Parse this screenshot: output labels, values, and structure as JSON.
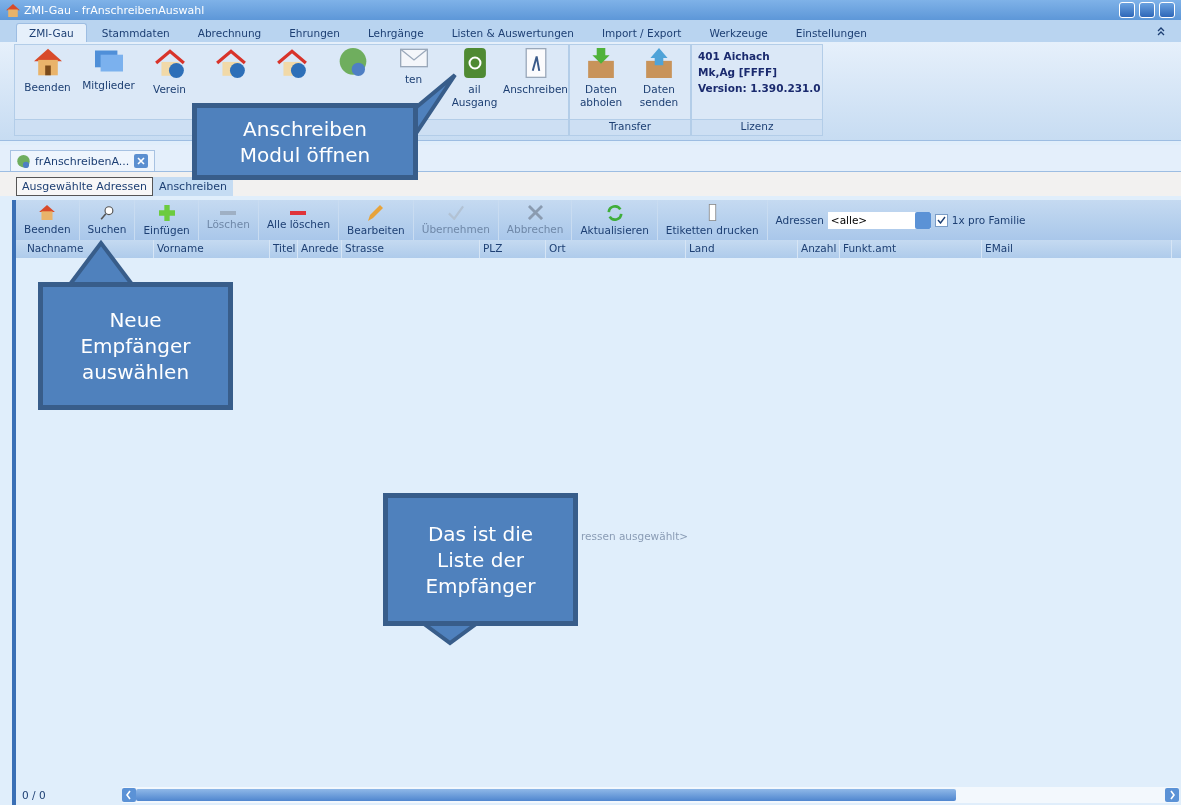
{
  "window": {
    "title": "ZMI-Gau - frAnschreibenAuswahl"
  },
  "ribbon_tabs": [
    {
      "label": "ZMI-Gau",
      "selected": true
    },
    {
      "label": "Stammdaten",
      "selected": false
    },
    {
      "label": "Abrechnung",
      "selected": false
    },
    {
      "label": "Ehrungen",
      "selected": false
    },
    {
      "label": "Lehrgänge",
      "selected": false
    },
    {
      "label": "Listen & Auswertungen",
      "selected": false
    },
    {
      "label": "Import / Export",
      "selected": false
    },
    {
      "label": "Werkzeuge",
      "selected": false
    },
    {
      "label": "Einstellungen",
      "selected": false
    }
  ],
  "ribbon_groups": [
    {
      "buttons": [
        {
          "kind": "labeled",
          "lines": [
            "Beenden"
          ]
        },
        {
          "kind": "labeled",
          "lines": [
            "Mitglieder"
          ]
        },
        {
          "kind": "labeled",
          "lines": [
            "Verein"
          ]
        },
        {
          "kind": "icon"
        },
        {
          "kind": "icon"
        },
        {
          "kind": "icon"
        },
        {
          "kind": "labeled",
          "lines": [
            "ten"
          ]
        },
        {
          "kind": "labeled",
          "lines": [
            "ail",
            "Ausgang"
          ]
        },
        {
          "kind": "labeled",
          "lines": [
            "Anschreiben"
          ]
        }
      ]
    },
    {
      "label": "Transfer",
      "buttons": [
        {
          "kind": "labeled",
          "lines": [
            "Daten",
            "abholen"
          ]
        },
        {
          "kind": "labeled",
          "lines": [
            "Daten",
            "senden"
          ]
        }
      ]
    }
  ],
  "license": {
    "label": "Lizenz",
    "lines": [
      "401 Aichach",
      "Mk,Ag [FFFF]",
      "Version: 1.390.231.0"
    ]
  },
  "document_tab": {
    "label": "frAnschreibenA..."
  },
  "sub_tabs": [
    {
      "label": "Ausgewählte Adressen",
      "selected": true
    },
    {
      "label": "Anschreiben",
      "selected": false
    }
  ],
  "toolbar": [
    {
      "label": "Beenden",
      "disabled": false
    },
    {
      "label": "Suchen",
      "disabled": false
    },
    {
      "label": "Einfügen",
      "disabled": false
    },
    {
      "label": "Löschen",
      "disabled": true
    },
    {
      "label": "Alle löschen",
      "disabled": false
    },
    {
      "label": "Bearbeiten",
      "disabled": false
    },
    {
      "label": "Übernehmen",
      "disabled": true
    },
    {
      "label": "Abbrechen",
      "disabled": true
    },
    {
      "label": "Aktualisieren",
      "disabled": false
    },
    {
      "label": "Etiketten drucken",
      "disabled": false
    }
  ],
  "address_filter": {
    "label": "Adressen",
    "value": "<alle>",
    "checkbox": {
      "label": "1x pro Familie",
      "checked": true
    }
  },
  "table": {
    "columns": [
      "Nachname",
      "Vorname",
      "Titel",
      "Anrede",
      "Strasse",
      "PLZ",
      "Ort",
      "Land",
      "Anzahl",
      "Funkt.amt",
      "EMail"
    ],
    "empty_text": "ressen ausgewählt>"
  },
  "status_bar": {
    "count": "0 / 0"
  },
  "callouts": [
    "Anschreiben Modul öffnen",
    "Neue Empfänger auswählen",
    "Das ist die Liste der Empfänger"
  ]
}
